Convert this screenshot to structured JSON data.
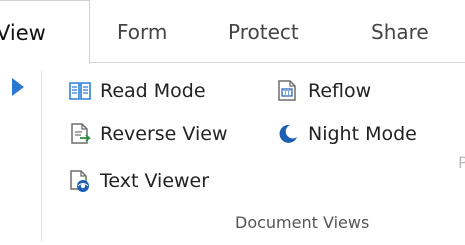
{
  "tabs": {
    "view": "View",
    "form": "Form",
    "protect": "Protect",
    "share": "Share"
  },
  "commands": {
    "read_mode": "Read Mode",
    "reverse_view": "Reverse View",
    "text_viewer": "Text Viewer",
    "reflow": "Reflow",
    "night_mode": "Night Mode"
  },
  "group": {
    "label": "Document Views"
  },
  "edge_text": "P",
  "colors": {
    "accent": "#2b78d0",
    "icon_gray": "#6e6e6e",
    "icon_blue": "#2f7fdc",
    "icon_green": "#2f8a45",
    "icon_dark_blue": "#1c5fb5"
  },
  "icons": {
    "expand": "expand-arrow-icon",
    "read_mode": "book-icon",
    "reverse_view": "reverse-page-icon",
    "text_viewer": "text-viewer-icon",
    "reflow": "reflow-icon",
    "night_mode": "moon-icon"
  }
}
